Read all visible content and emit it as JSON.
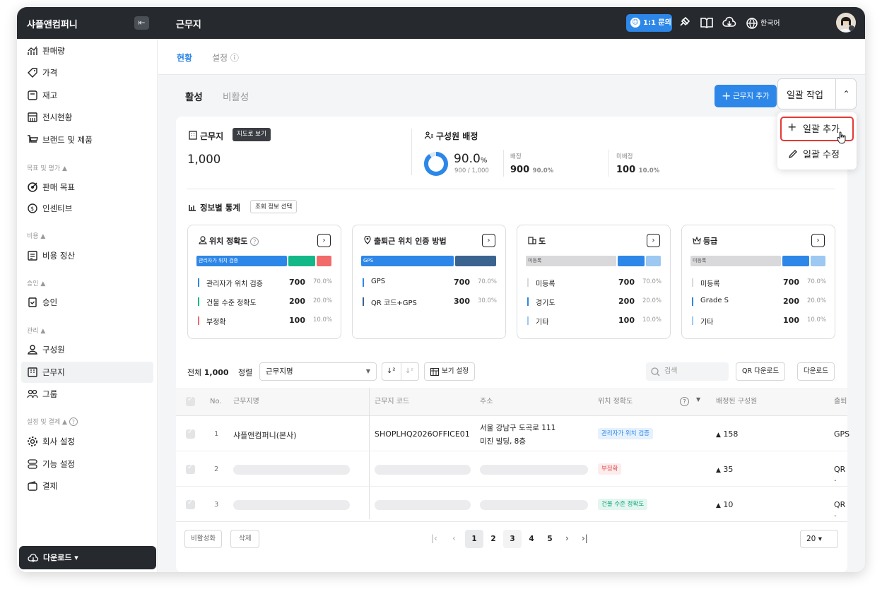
{
  "topbar": {
    "company": "샤플앤컴퍼니",
    "page_title": "근무지",
    "inquiry": "1:1 문의",
    "language": "한국어"
  },
  "sidebar": {
    "items": [
      {
        "label": "판매량",
        "icon": "sales-chart-icon"
      },
      {
        "label": "가격",
        "icon": "price-tag-icon"
      },
      {
        "label": "재고",
        "icon": "inventory-icon"
      },
      {
        "label": "전시현황",
        "icon": "display-icon"
      },
      {
        "label": "브랜드 및 제품",
        "icon": "cart-icon"
      }
    ],
    "sections": {
      "goals": "목표 및 평가 ▲",
      "cost": "비용 ▲",
      "approval": "승인 ▲",
      "manage": "관리 ▲",
      "settings": "설정 및 결제 ▲"
    },
    "goals": [
      {
        "label": "판매 목표",
        "icon": "target-icon"
      },
      {
        "label": "인센티브",
        "icon": "coin-icon"
      }
    ],
    "cost": [
      {
        "label": "비용 정산",
        "icon": "receipt-icon"
      }
    ],
    "approval": [
      {
        "label": "승인",
        "icon": "clipboard-check-icon"
      }
    ],
    "manage": [
      {
        "label": "구성원",
        "icon": "user-icon"
      },
      {
        "label": "근무지",
        "icon": "building-icon"
      },
      {
        "label": "그룹",
        "icon": "group-icon"
      }
    ],
    "settings": [
      {
        "label": "회사 설정",
        "icon": "gear-icon"
      },
      {
        "label": "기능 설정",
        "icon": "toggle-icon"
      },
      {
        "label": "결제",
        "icon": "wallet-icon"
      }
    ],
    "download": "다운로드 ▾"
  },
  "tabs": {
    "status": "현황",
    "settings": "설정 ⓘ"
  },
  "subtabs": {
    "active": "활성",
    "inactive": "비활성"
  },
  "actions": {
    "add": "근무지 추가",
    "bulk": "일괄 작업",
    "bulk_add": "일괄 추가",
    "bulk_edit": "일괄 수정"
  },
  "summary": {
    "workplace_label": "근무지",
    "map_view": "지도로 보기",
    "workplace_count": "1,000",
    "assign_label": "구성원 배정",
    "ratio": "90.0",
    "ratio_unit": "%",
    "ratio_detail": "900 / 1,000",
    "assigned_label": "배정",
    "assigned": "900",
    "assigned_pct": "90.0%",
    "unassigned_label": "미배정",
    "unassigned": "100",
    "unassigned_pct": "10.0%"
  },
  "stats": {
    "label": "정보별 통계",
    "select": "조회 정보 선택",
    "cards": [
      {
        "title": "위치 정확도",
        "bar_label": "관리자가 위치 검증",
        "rows": [
          [
            "관리자가 위치 검증",
            "700",
            "70.0%"
          ],
          [
            "건물 수준 정확도",
            "200",
            "20.0%"
          ],
          [
            "부정확",
            "100",
            "10.0%"
          ]
        ],
        "colors": [
          "#2d87e8",
          "#13b889",
          "#f26a6a"
        ]
      },
      {
        "title": "출퇴근 위치 인증 방법",
        "bar_label": "GPS",
        "rows": [
          [
            "GPS",
            "700",
            "70.0%"
          ],
          [
            "QR 코드+GPS",
            "300",
            "30.0%"
          ]
        ],
        "colors": [
          "#2d87e8",
          "#3a6390"
        ]
      },
      {
        "title": "도",
        "bar_label": "미등록",
        "rows": [
          [
            "미등록",
            "700",
            "70.0%"
          ],
          [
            "경기도",
            "200",
            "20.0%"
          ],
          [
            "기타",
            "100",
            "10.0%"
          ]
        ],
        "colors": [
          "#d9d9db",
          "#2d87e8",
          "#9cc8f2"
        ]
      },
      {
        "title": "등급",
        "bar_label": "미등록",
        "rows": [
          [
            "미등록",
            "700",
            "70.0%"
          ],
          [
            "Grade S",
            "200",
            "20.0%"
          ],
          [
            "기타",
            "100",
            "10.0%"
          ]
        ],
        "colors": [
          "#d9d9db",
          "#2d87e8",
          "#9cc8f2"
        ]
      }
    ]
  },
  "toolbar": {
    "total_label": "전체",
    "total": "1,000",
    "sort_label": "정렬",
    "sort_value": "근무지명",
    "view_settings": "보기 설정",
    "search_placeholder": "검색",
    "qr_download": "QR 다운로드",
    "download": "다운로드"
  },
  "table": {
    "headers": [
      "No.",
      "근무지명",
      "근무지 코드",
      "주소",
      "위치 정확도",
      "배정된 구성원",
      "출퇴"
    ],
    "rows": [
      {
        "no": "1",
        "name": "샤플앤컴퍼니(본사)",
        "code": "SHOPLHQ2026OFFICE01",
        "addr1": "서울 강남구 도곡로 111",
        "addr2": "미진 빌딩, 8층",
        "accuracy": "관리자가 위치 검증",
        "members": "158",
        "method": "GPS"
      },
      {
        "no": "2",
        "accuracy": "부정확",
        "members": "35",
        "method": "QR ."
      },
      {
        "no": "3",
        "accuracy": "건물 수준 정확도",
        "members": "10",
        "method": "QR ."
      }
    ]
  },
  "footer": {
    "deactivate": "비활성화",
    "delete": "삭제",
    "pages": [
      "1",
      "2",
      "3",
      "4",
      "5"
    ],
    "page_size": "20 ▾"
  }
}
